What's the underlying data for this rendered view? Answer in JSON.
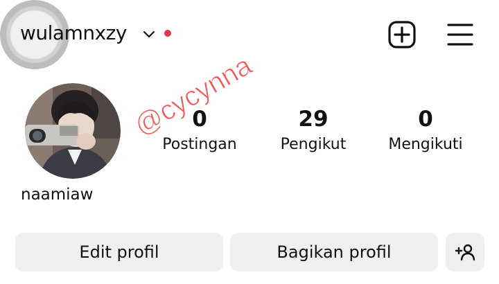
{
  "header": {
    "username": "wulamnxzy",
    "icons": {
      "switch_account": "chevron-down-icon",
      "create": "plus-square-icon",
      "menu": "hamburger-menu-icon"
    },
    "notification_dot_color": "#e0394e"
  },
  "profile": {
    "display_name": "naamiaw",
    "stats": [
      {
        "value": "0",
        "label": "Postingan"
      },
      {
        "value": "29",
        "label": "Pengikut"
      },
      {
        "value": "0",
        "label": "Mengikuti"
      }
    ]
  },
  "watermark": "@cycynna",
  "actions": {
    "edit_label": "Edit profil",
    "share_label": "Bagikan profil",
    "discover_icon": "add-person-icon"
  }
}
